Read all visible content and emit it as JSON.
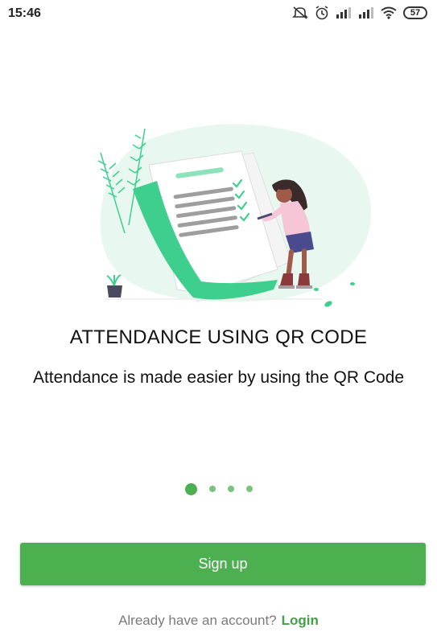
{
  "status_bar": {
    "time": "15:46",
    "battery_level": "57",
    "icons": [
      "mute-icon",
      "alarm-icon",
      "signal-icon",
      "signal-icon",
      "wifi-icon",
      "battery-icon"
    ]
  },
  "onboarding": {
    "title": "ATTENDANCE USING QR CODE",
    "subtitle": "Attendance is made easier by using the QR Code",
    "page_count": 4,
    "current_page": 1
  },
  "actions": {
    "signup_label": "Sign up",
    "login_prompt": "Already have an account?",
    "login_label": "Login"
  },
  "colors": {
    "accent": "#4caf50",
    "illustration_green": "#3ecf8e",
    "blob": "#e8f7ef"
  }
}
